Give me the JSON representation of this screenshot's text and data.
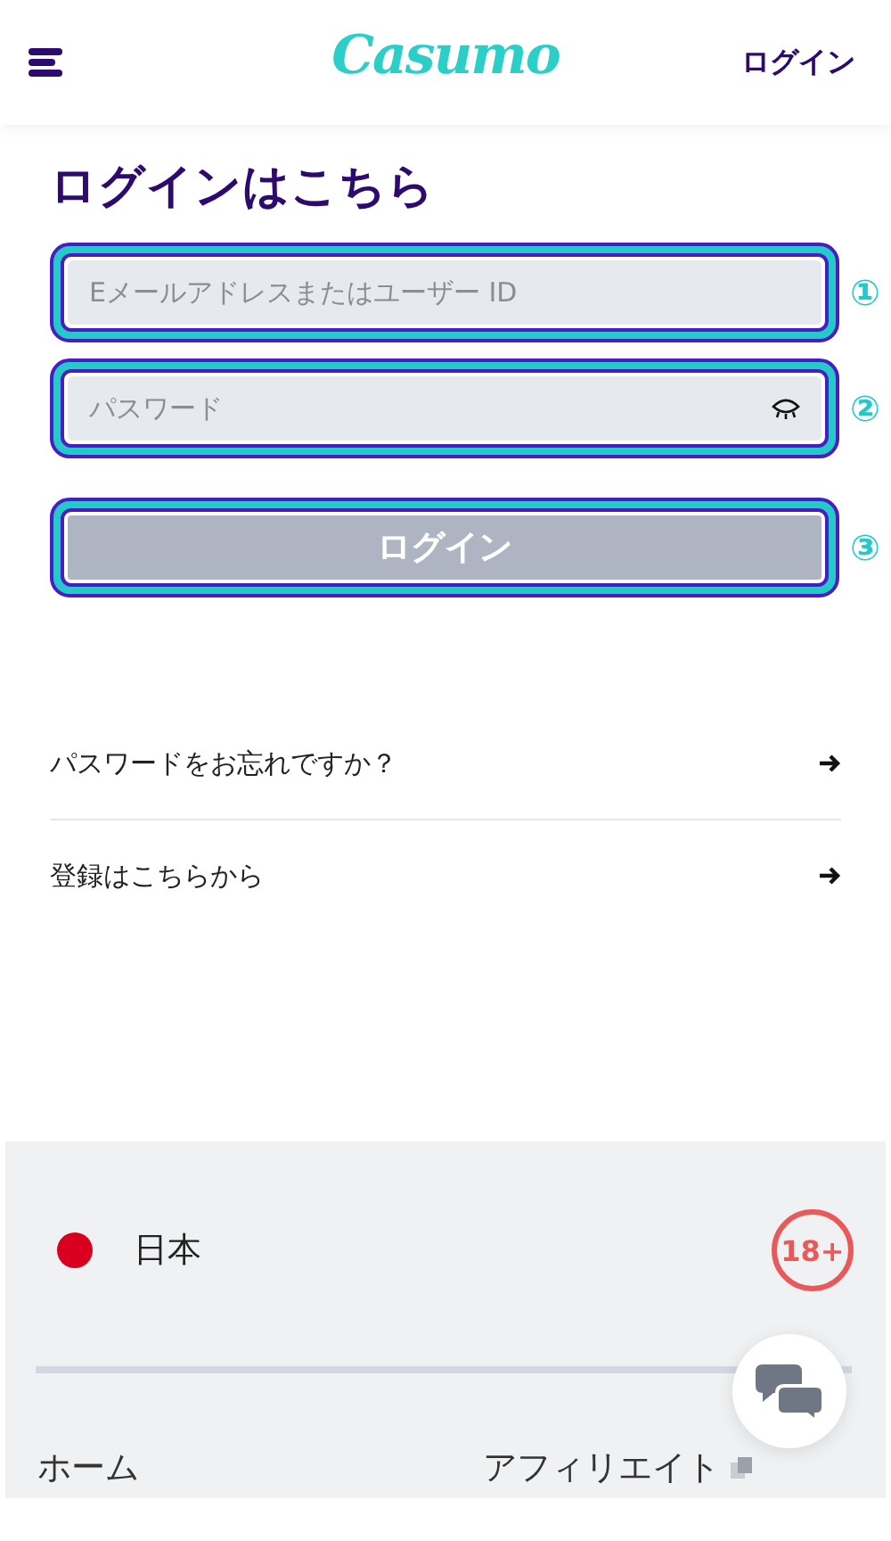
{
  "header": {
    "logo": "Casumo",
    "login_link": "ログイン"
  },
  "title": "ログインはこちら",
  "fields": [
    {
      "kind": "text",
      "placeholder": "Eメールアドレスまたはユーザー ID",
      "marker": "①"
    },
    {
      "kind": "password",
      "placeholder": "パスワード",
      "marker": "②"
    }
  ],
  "submit": {
    "label": "ログイン",
    "disabled": true,
    "marker": "③"
  },
  "links": [
    "パスワードをお忘れですか？",
    "登録はこちらから"
  ],
  "footer": {
    "country": "日本",
    "age_badge": "18+",
    "nav": [
      "ホーム",
      "アフィリエイト"
    ]
  }
}
